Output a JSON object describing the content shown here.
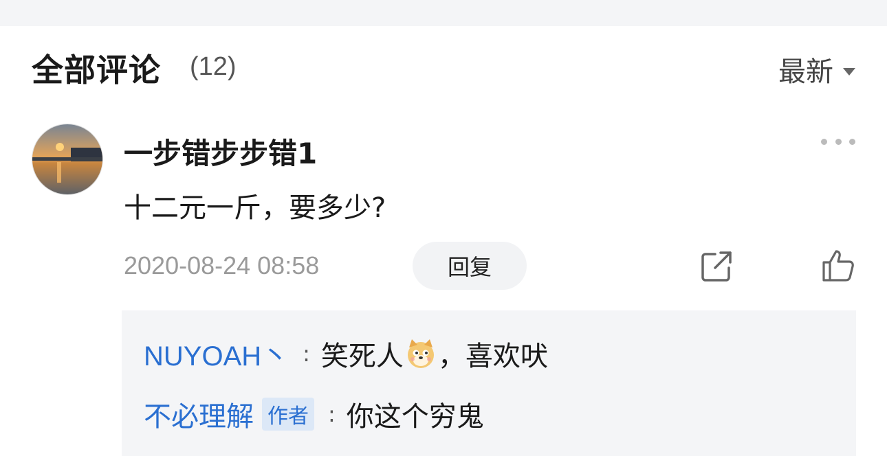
{
  "header": {
    "title": "全部评论",
    "count": "(12)",
    "sort_label": "最新"
  },
  "comment": {
    "username": "一步错步步错1",
    "text": "十二元一斤，要多少?",
    "timestamp": "2020-08-24 08:58",
    "reply_label": "回复"
  },
  "replies": [
    {
      "user": "NUYOAH丶",
      "text_before_emoji": "笑死人",
      "emoji": "dog-face-emoji",
      "text_after_emoji": "，喜欢吠"
    },
    {
      "user": "不必理解",
      "tag": "作者",
      "text": "你这个穷鬼"
    }
  ],
  "colors": {
    "link_blue": "#2a6fd1",
    "muted_gray": "#9a9a9a",
    "panel_bg": "#f4f5f7"
  }
}
